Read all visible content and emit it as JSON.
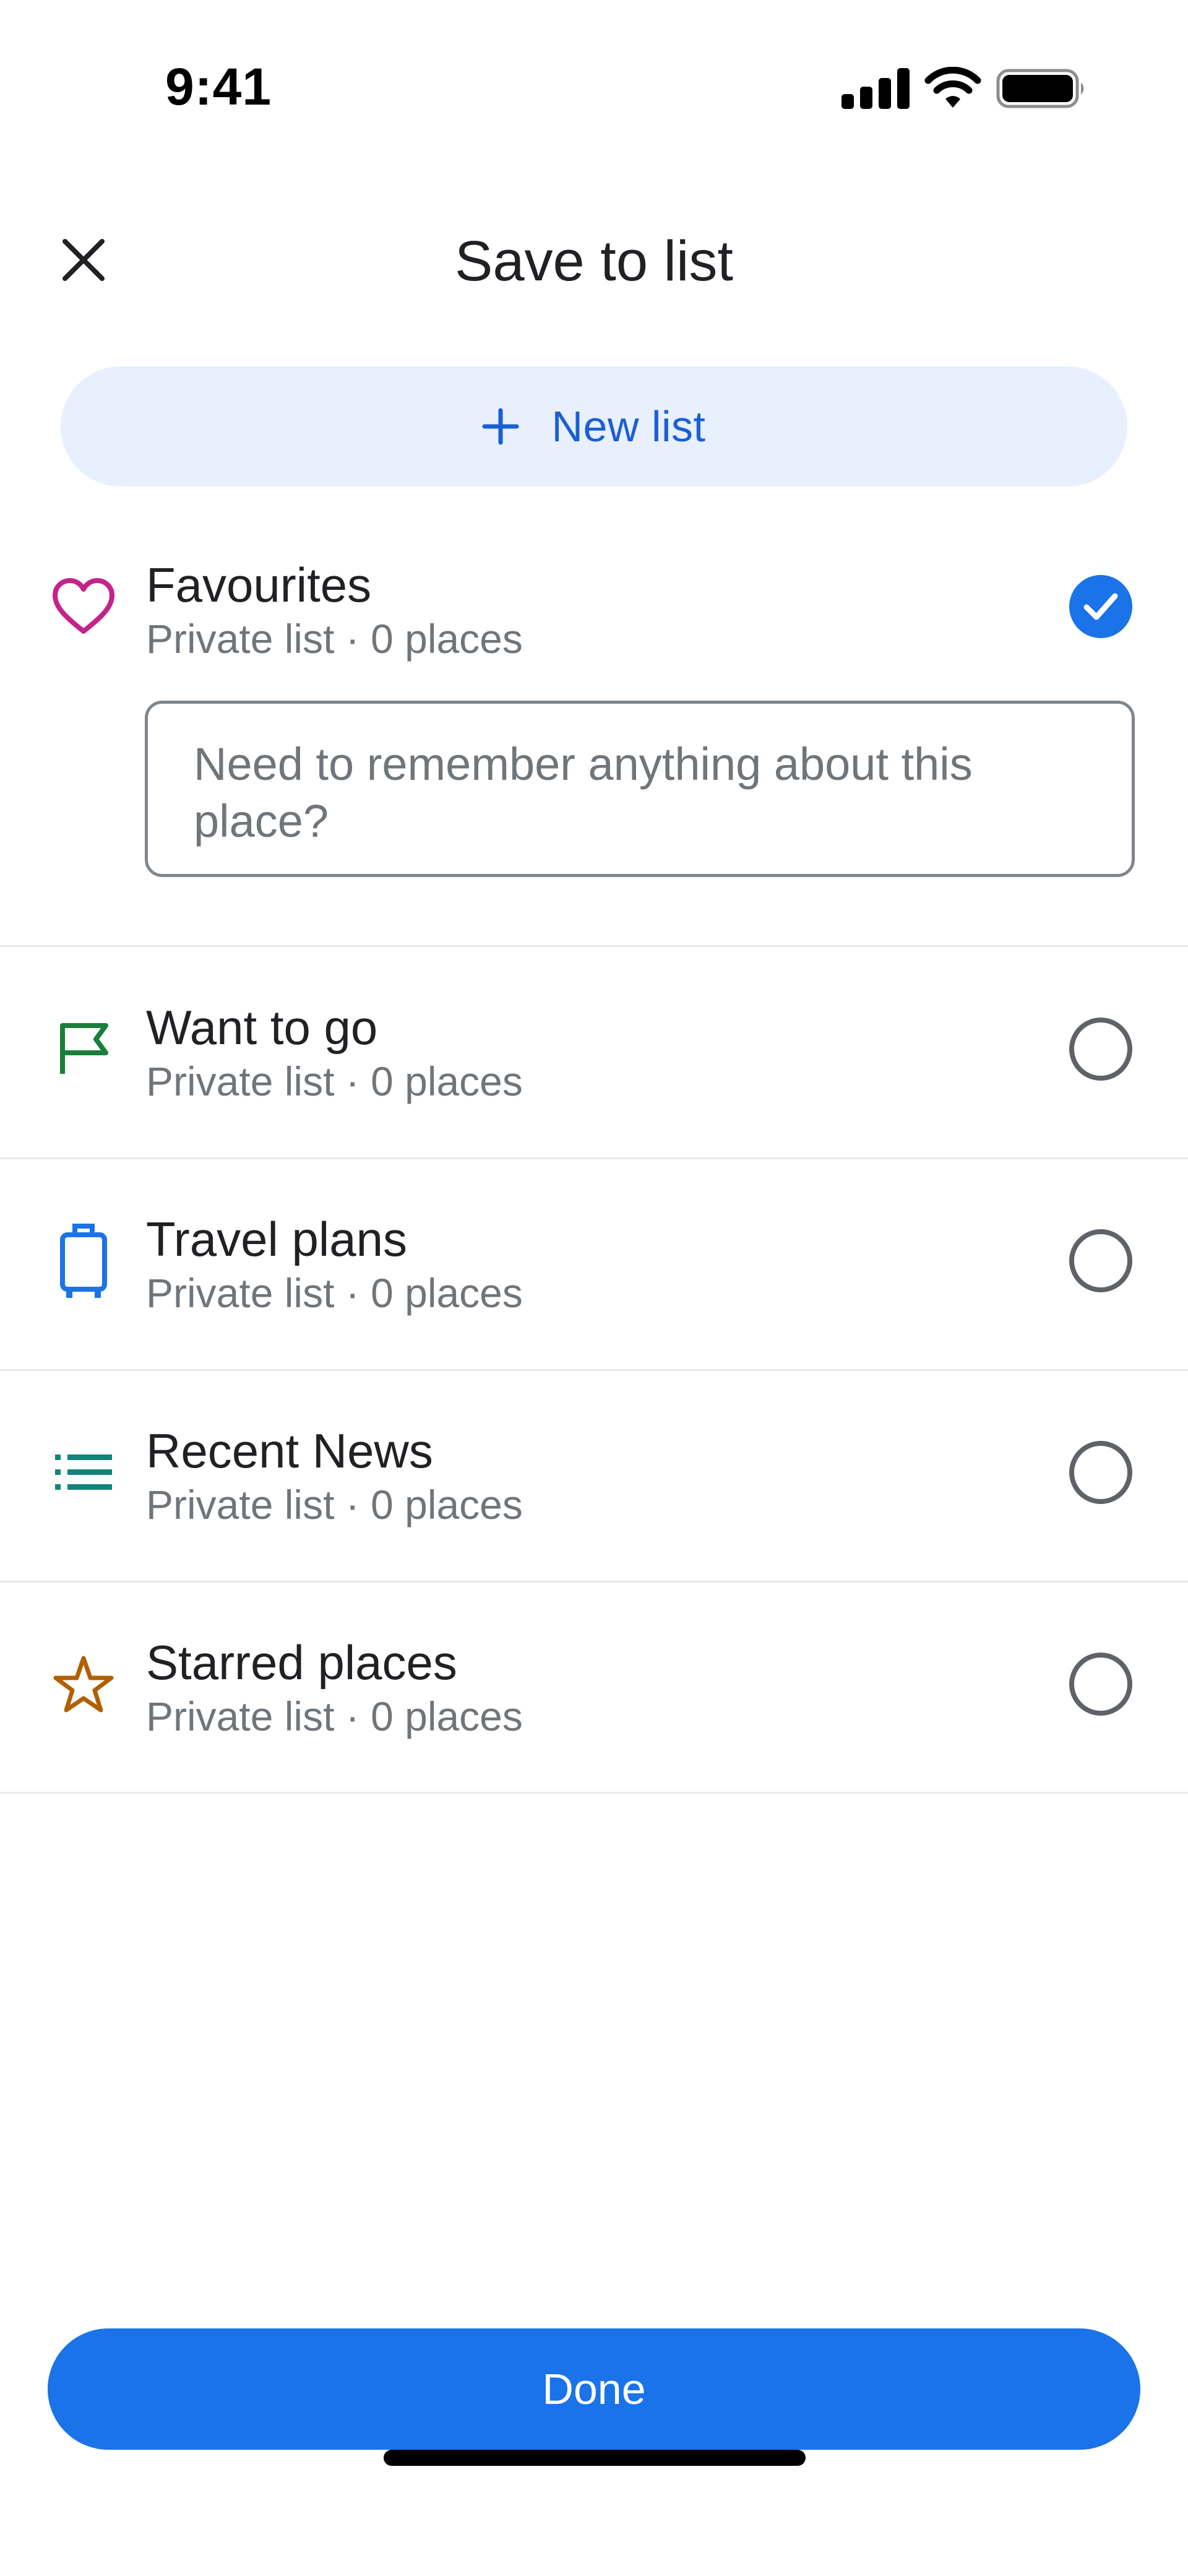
{
  "status_bar": {
    "time": "9:41"
  },
  "header": {
    "title": "Save to list",
    "close_icon": "close-icon"
  },
  "new_list": {
    "label": "New list",
    "icon": "plus-icon",
    "color": "#1a5fd4"
  },
  "lists": [
    {
      "title": "Favourites",
      "subtitle": "Private list · 0 places",
      "icon": "heart-icon",
      "icon_color": "#c5228a",
      "checked": true
    },
    {
      "title": "Want to go",
      "subtitle": "Private list · 0 places",
      "icon": "flag-icon",
      "icon_color": "#188038",
      "checked": false
    },
    {
      "title": "Travel plans",
      "subtitle": "Private list · 0 places",
      "icon": "suitcase-icon",
      "icon_color": "#1a73e8",
      "checked": false
    },
    {
      "title": "Recent News",
      "subtitle": "Private list · 0 places",
      "icon": "list-icon",
      "icon_color": "#12847a",
      "checked": false
    },
    {
      "title": "Starred places",
      "subtitle": "Private list · 0 places",
      "icon": "star-icon",
      "icon_color": "#b06000",
      "checked": false
    }
  ],
  "note": {
    "placeholder": "Need to remember anything about this place?",
    "value": ""
  },
  "done": {
    "label": "Done",
    "color": "#1a73e8"
  }
}
